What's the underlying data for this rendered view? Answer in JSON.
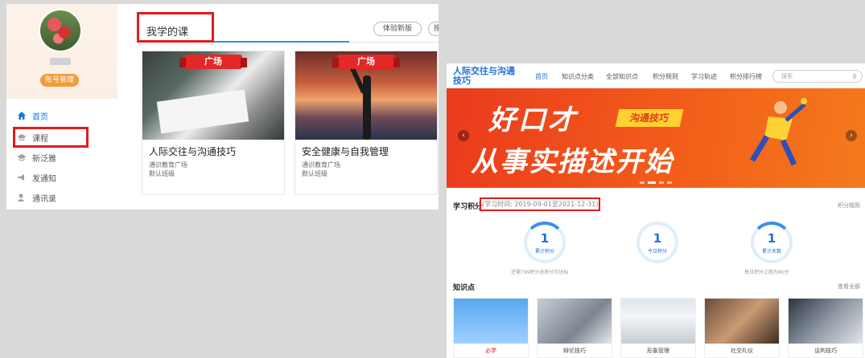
{
  "left": {
    "account_button": "账号管理",
    "nav": [
      {
        "label": "首页",
        "icon": "home-icon"
      },
      {
        "label": "课程",
        "icon": "graduation-cap-icon"
      },
      {
        "label": "新泛雅",
        "icon": "graduation-cap-icon"
      },
      {
        "label": "发通知",
        "icon": "megaphone-icon"
      },
      {
        "label": "通讯录",
        "icon": "contacts-icon"
      }
    ],
    "my_course_title": "我学的课",
    "try_button": "体验新版",
    "try_button2": "搜",
    "courses": [
      {
        "ribbon": "广场",
        "name": "人际交往与沟通技巧",
        "org": "通识教育广场",
        "class": "默认班级"
      },
      {
        "ribbon": "广场",
        "name": "安全健康与自我管理",
        "org": "通识教育广场",
        "class": "默认班级"
      }
    ]
  },
  "right": {
    "site_title": "人际交往与沟通技巧",
    "nav": [
      "首页",
      "知识点分类",
      "全部知识点",
      "积分规则",
      "学习轨迹",
      "积分排行榜"
    ],
    "search_placeholder": "搜索",
    "banner": {
      "line1": "好口才",
      "tag": "沟通技巧",
      "line2": "从事实描述开始"
    },
    "points_title": "学习积分",
    "study_time": "(学习时间: 2019-09-01至2021-12-31)",
    "points_rule_link": "积分规则",
    "stats": [
      {
        "value": "1",
        "label": "累计积分",
        "note": "还需799积分总积分可达标"
      },
      {
        "value": "1",
        "label": "今日积分",
        "note": ""
      },
      {
        "value": "1",
        "label": "累计天数",
        "note": "每日积分上限为80分"
      }
    ],
    "knowledge_title": "知识点",
    "view_all": "查看全部",
    "knowledge_cards": [
      "必学",
      "辩论技巧",
      "形象管理",
      "社交礼仪",
      "谈判技巧"
    ]
  },
  "colors": {
    "accent": "#1e6fd9",
    "highlight": "#e21c1c",
    "orange": "#f29b38"
  }
}
